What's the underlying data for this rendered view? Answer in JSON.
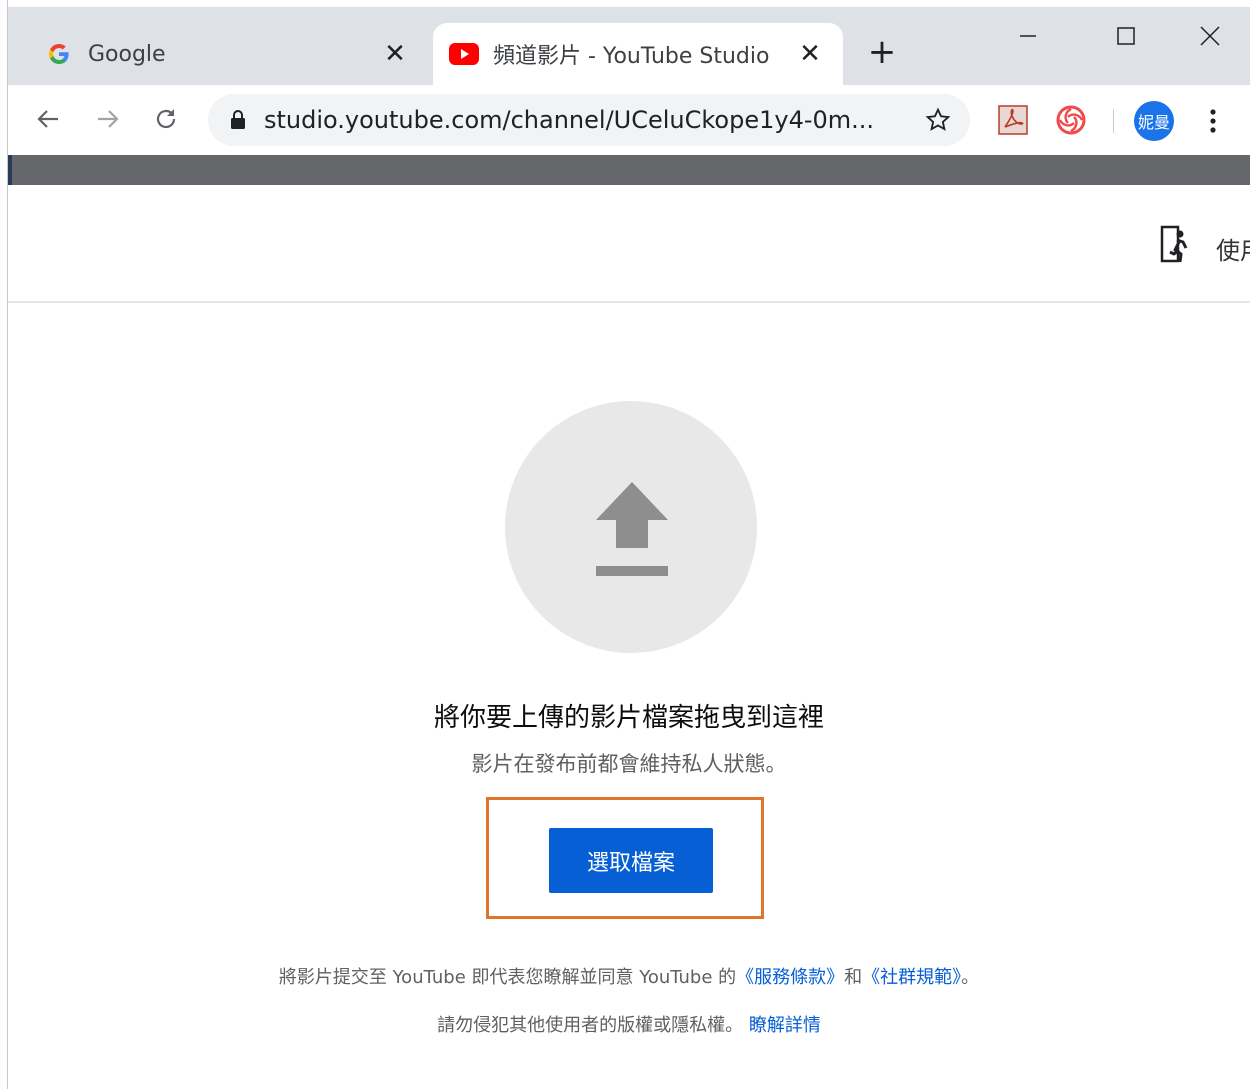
{
  "tabs": [
    {
      "label": "Google",
      "icon": "google-g-icon"
    },
    {
      "label": "頻道影片 - YouTube Studio",
      "icon": "youtube-icon"
    }
  ],
  "toolbar": {
    "url": "studio.youtube.com/channel/UCeluCkope1y4-0m...",
    "avatar_text": "妮曼"
  },
  "header": {
    "exit_label": "使用"
  },
  "upload": {
    "title": "將你要上傳的影片檔案拖曳到這裡",
    "subtitle": "影片在發布前都會維持私人狀態。",
    "button_label": "選取檔案"
  },
  "footer": {
    "line1_prefix": "將影片提交至 YouTube 即代表您瞭解並同意 YouTube 的",
    "terms_link": "《服務條款》",
    "and_text": "和",
    "guidelines_link": "《社群規範》",
    "line1_suffix": "。",
    "line2_text": "請勿侵犯其他使用者的版權或隱私權。",
    "learn_more": "瞭解詳情"
  },
  "colors": {
    "accent": "#065fd4",
    "highlight": "#e0742a",
    "tabstrip": "#dee1e6"
  }
}
